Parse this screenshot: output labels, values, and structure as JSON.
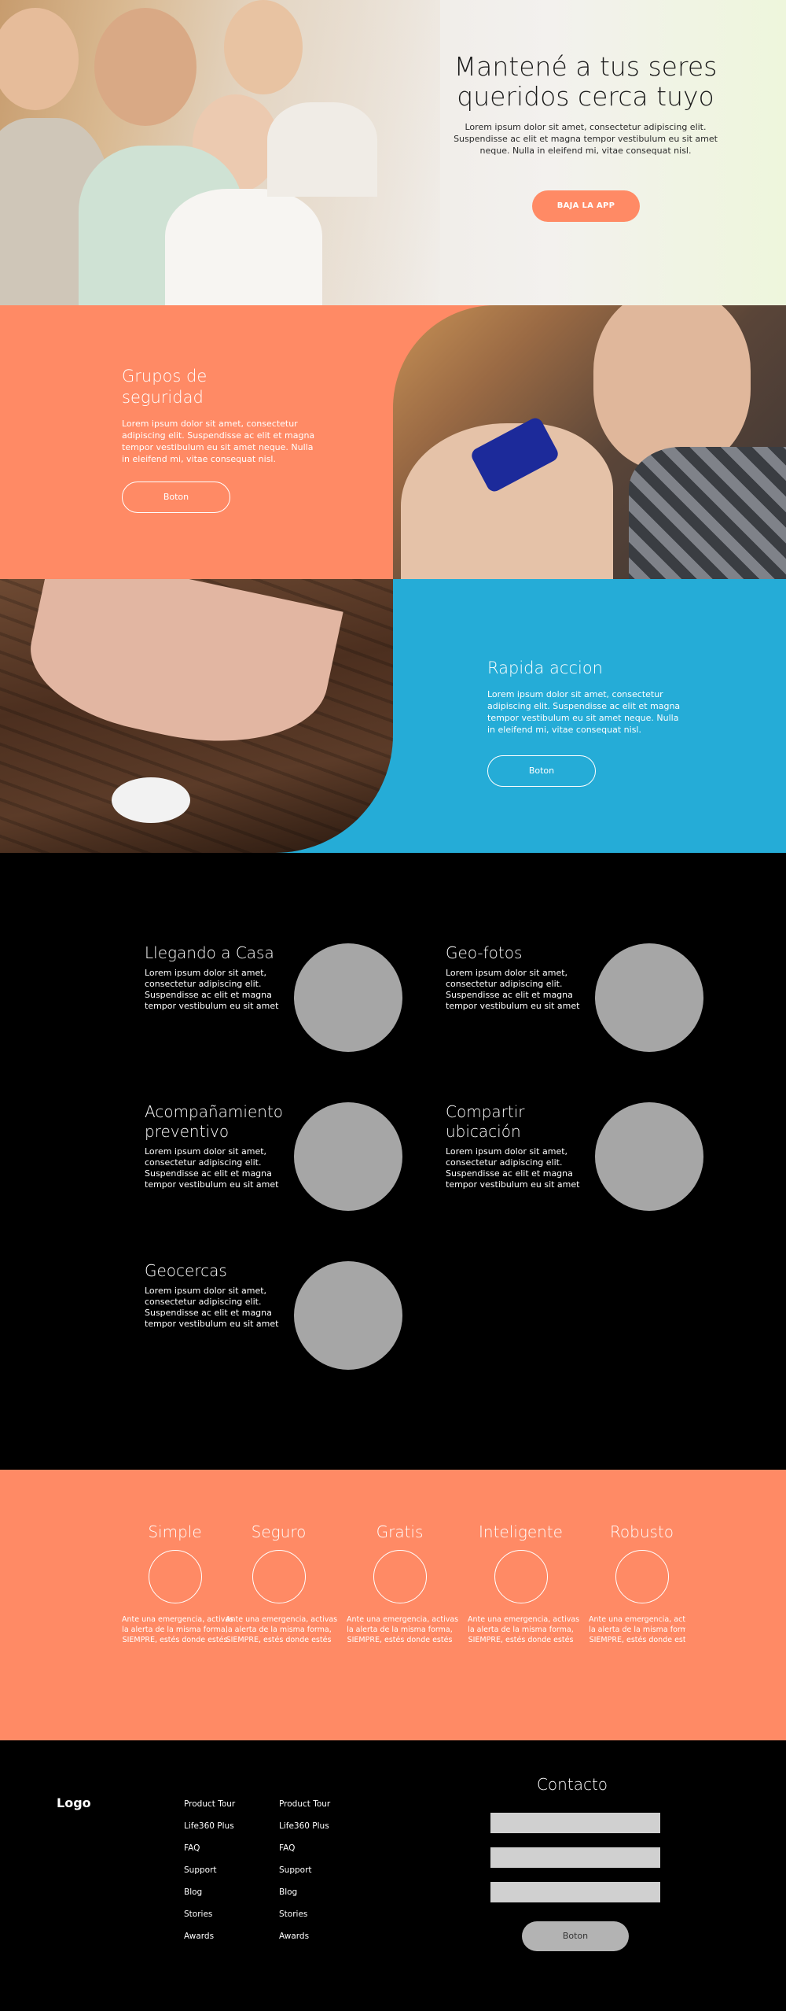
{
  "hero": {
    "title_line1": "Mantené a tus seres",
    "title_line2": "queridos cerca tuyo",
    "text": "Lorem ipsum dolor sit amet, consectetur adipiscing elit. Suspendisse ac elit et magna tempor vestibulum eu sit amet neque. Nulla in eleifend mi, vitae consequat nisl.",
    "cta_label": "BAJA LA APP"
  },
  "feature_security": {
    "title_line1": "Grupos de",
    "title_line2": "seguridad",
    "text": "Lorem ipsum dolor sit amet, consectetur adipiscing elit. Suspendisse ac elit et magna tempor vestibulum eu sit amet neque. Nulla in eleifend mi, vitae consequat nisl.",
    "button_label": "Boton"
  },
  "feature_quick": {
    "title": "Rapida accion",
    "text": "Lorem ipsum dolor sit amet, consectetur adipiscing elit. Suspendisse ac elit et magna tempor vestibulum eu sit amet neque. Nulla in eleifend mi, vitae consequat nisl.",
    "button_label": "Boton"
  },
  "features_grid": [
    {
      "title": "Llegando a Casa",
      "text": "Lorem ipsum dolor sit amet, consectetur adipiscing elit. Suspendisse ac elit et magna tempor vestibulum eu sit amet"
    },
    {
      "title": "Geo-fotos",
      "text": "Lorem ipsum dolor sit amet, consectetur adipiscing elit. Suspendisse ac elit et magna tempor vestibulum eu sit amet"
    },
    {
      "title": "Acompañamiento preventivo",
      "text": "Lorem ipsum dolor sit amet, consectetur adipiscing elit. Suspendisse ac elit et magna tempor vestibulum eu sit amet"
    },
    {
      "title": "Compartir ubicación",
      "text": "Lorem ipsum dolor sit amet, consectetur adipiscing elit. Suspendisse ac elit et magna tempor vestibulum eu sit amet"
    },
    {
      "title": "Geocercas",
      "text": "Lorem ipsum dolor sit amet, consectetur adipiscing elit. Suspendisse ac elit et magna tempor vestibulum eu sit amet"
    }
  ],
  "pillars": [
    {
      "title": "Simple",
      "text_line1": "Ante una emergencia, activas",
      "text_line2": "la alerta de la misma forma,",
      "text_line3": "SIEMPRE, estés donde estés"
    },
    {
      "title": "Seguro",
      "text_line1": "Ante una emergencia, activas",
      "text_line2": "la alerta de la misma forma,",
      "text_line3": "SIEMPRE, estés donde estés"
    },
    {
      "title": "Gratis",
      "text_line1": "Ante una emergencia, activas",
      "text_line2": "la alerta de la misma forma,",
      "text_line3": "SIEMPRE, estés donde estés"
    },
    {
      "title": "Inteligente",
      "text_line1": "Ante una emergencia, activas",
      "text_line2": "la alerta de la misma forma,",
      "text_line3": "SIEMPRE, estés donde estés"
    },
    {
      "title": "Robusto",
      "text_line1": "Ante una emergencia, activas",
      "text_line2": "la alerta de la misma forma,",
      "text_line3": "SIEMPRE, estés donde estés"
    }
  ],
  "footer": {
    "logo": "Logo",
    "col1": [
      "Product Tour",
      "Life360 Plus",
      "FAQ",
      "Support",
      "Blog",
      "Stories",
      "Awards"
    ],
    "col2": [
      "Product Tour",
      "Life360 Plus",
      "FAQ",
      "Support",
      "Blog",
      "Stories",
      "Awards"
    ],
    "contact_title": "Contacto",
    "contact_button": "Boton"
  },
  "colors": {
    "accent": "#ff8a65",
    "blue": "#25acd7",
    "placeholder_circle": "#a6a6a6"
  }
}
